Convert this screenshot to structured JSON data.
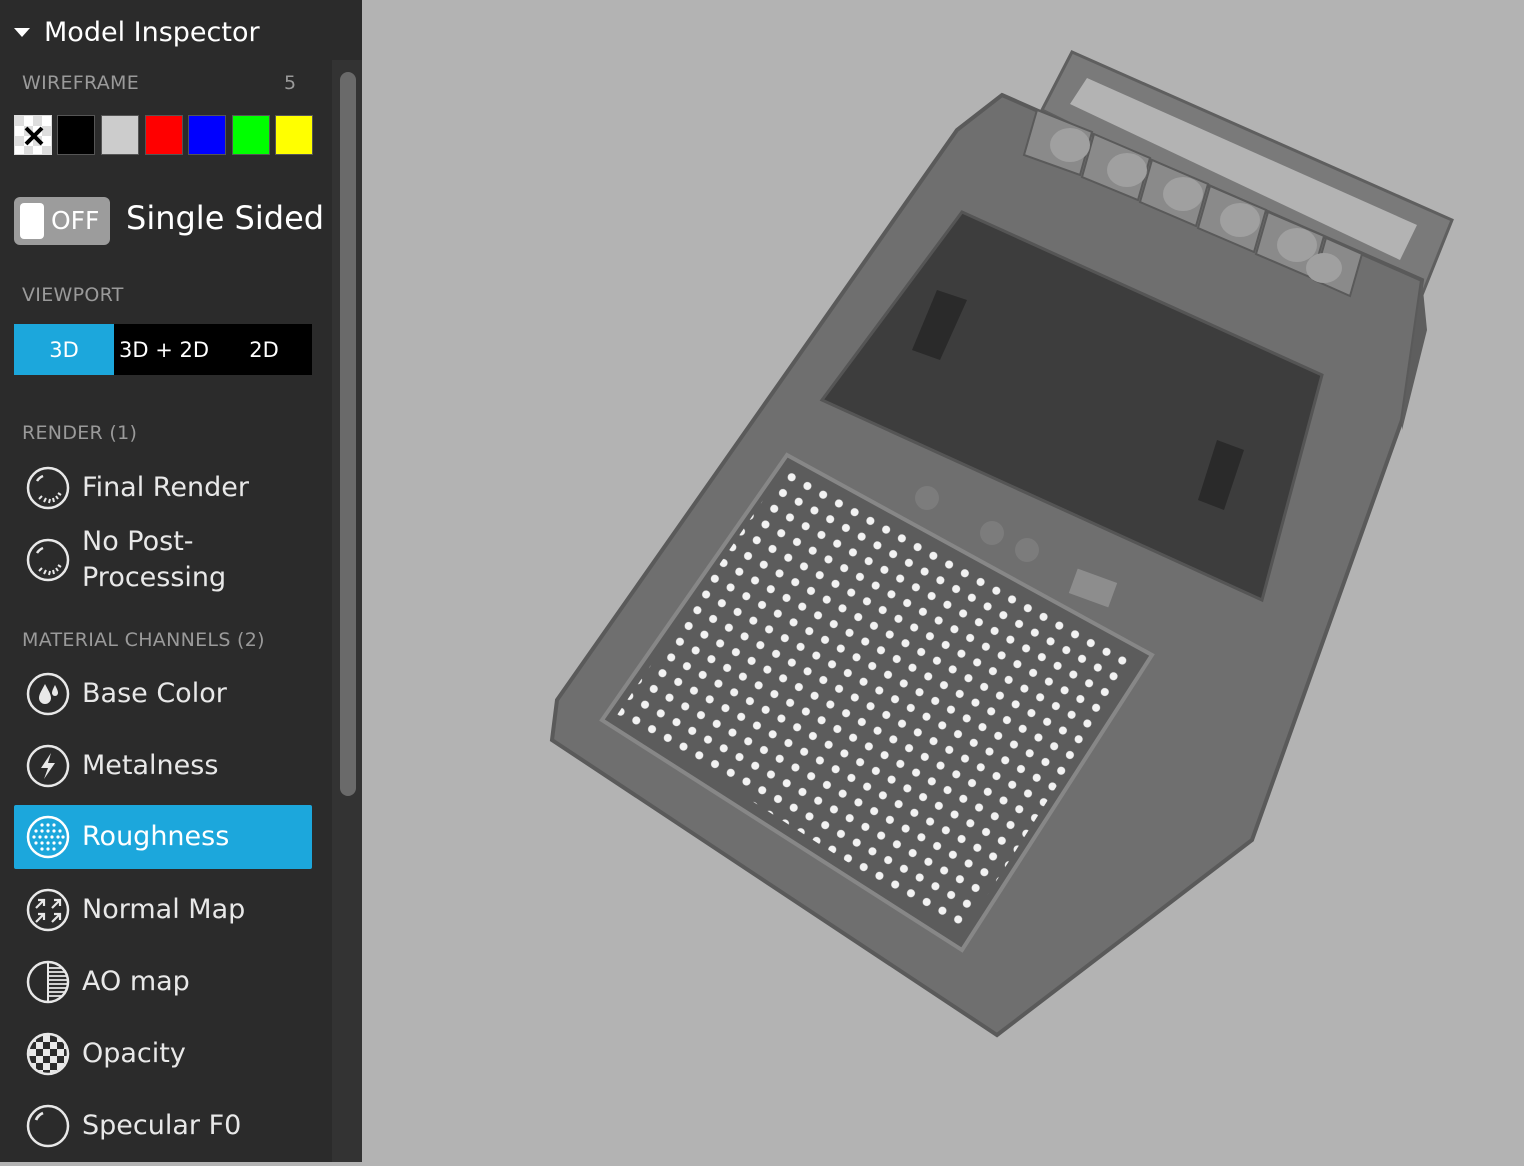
{
  "panel": {
    "title": "Model Inspector",
    "wireframe": {
      "label": "WIREFRAME",
      "count": "5",
      "swatches": [
        "none",
        "#000000",
        "#cccccc",
        "#ff0000",
        "#0000ff",
        "#00ff00",
        "#ffff00"
      ]
    },
    "single_sided": {
      "toggle_text": "OFF",
      "label": "Single Sided"
    },
    "viewport": {
      "label": "VIEWPORT",
      "options": [
        "3D",
        "3D + 2D",
        "2D"
      ],
      "selected": "3D"
    },
    "render": {
      "label": "RENDER (1)",
      "items": [
        {
          "label": "Final Render",
          "icon": "final-render-icon"
        },
        {
          "label": "No Post-Processing",
          "icon": "no-post-processing-icon"
        }
      ]
    },
    "material": {
      "label": "MATERIAL CHANNELS (2)",
      "items": [
        {
          "label": "Base Color",
          "icon": "base-color-icon"
        },
        {
          "label": "Metalness",
          "icon": "metalness-icon"
        },
        {
          "label": "Roughness",
          "icon": "roughness-icon",
          "active": true
        },
        {
          "label": "Normal Map",
          "icon": "normal-map-icon"
        },
        {
          "label": "AO map",
          "icon": "ao-map-icon"
        },
        {
          "label": "Opacity",
          "icon": "opacity-icon"
        },
        {
          "label": "Specular F0",
          "icon": "specular-f0-icon"
        }
      ]
    }
  },
  "colors": {
    "accent": "#1ca7dc",
    "panel_bg": "#2b2b2b",
    "viewport_bg": "#b3b3b3"
  }
}
